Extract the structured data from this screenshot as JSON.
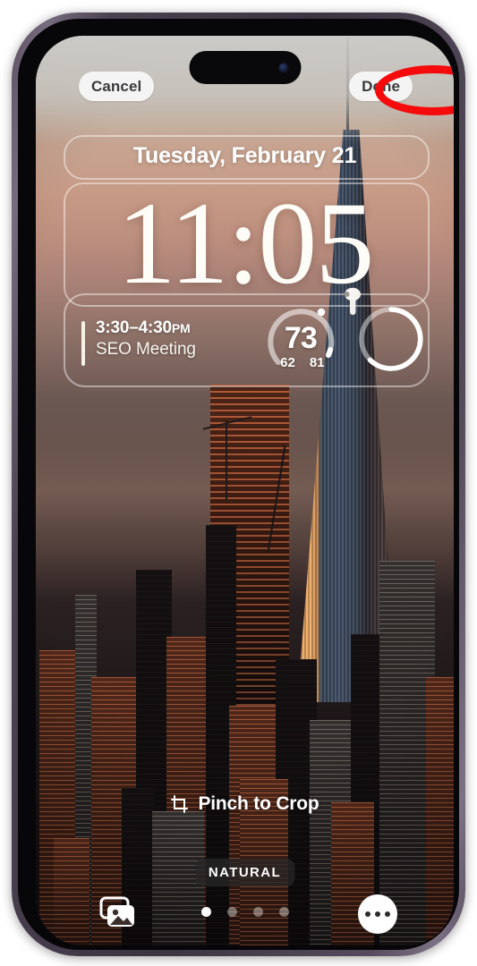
{
  "screen_type": "ios-lock-screen-wallpaper-editor",
  "toolbar": {
    "cancel_label": "Cancel",
    "done_label": "Done",
    "highlight_color": "#f50b0b",
    "highlight_target": "Done"
  },
  "lock_screen": {
    "date": "Tuesday, February 21",
    "time": "11:05",
    "widgets": {
      "calendar": {
        "time_range": "3:30–4:30",
        "time_period": "PM",
        "event_title": "SEO Meeting"
      },
      "weather": {
        "icon": "temperature-gauge-icon",
        "current": "73",
        "low": "62",
        "high": "81"
      },
      "battery": {
        "icon": "airpod-icon",
        "ring_percent": 78
      }
    }
  },
  "editor": {
    "crop_hint": "Pinch to Crop",
    "crop_icon": "crop-icon",
    "style_label": "NATURAL",
    "photos_icon": "photo-stack-icon",
    "more_icon": "ellipsis-icon",
    "page_dots": 4,
    "active_dot": 1
  },
  "wallpaper": {
    "subject": "New York City skyline at sunset with One World Trade Center"
  }
}
